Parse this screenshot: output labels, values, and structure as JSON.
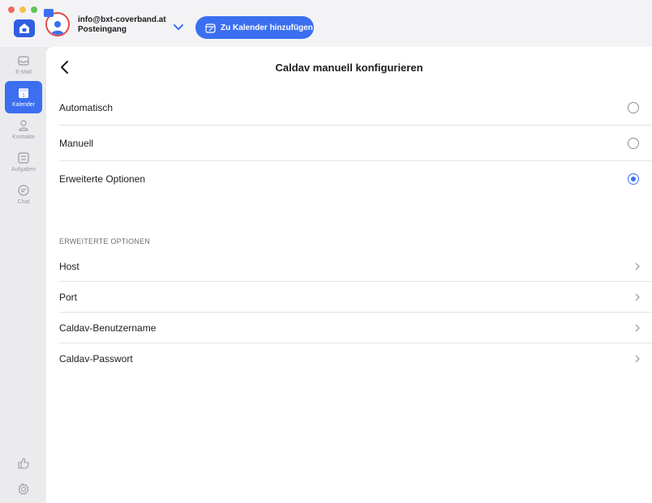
{
  "header": {
    "account_email": "info@bxt-coverband.at",
    "account_folder": "Posteingang",
    "add_calendar_label": "Zu Kalender hinzufügen",
    "accent_color": "#3b6ff0"
  },
  "sidebar": {
    "items": [
      {
        "label": "E-Mail",
        "icon": "mail-icon"
      },
      {
        "label": "Kalender",
        "icon": "calendar-icon",
        "active": true
      },
      {
        "label": "Kontakte",
        "icon": "contacts-icon"
      },
      {
        "label": "Aufgaben",
        "icon": "tasks-icon"
      },
      {
        "label": "Chat",
        "icon": "chat-icon"
      }
    ],
    "bottom_icons": [
      "thumbs-up-icon",
      "settings-gear-icon"
    ]
  },
  "page": {
    "title": "Caldav manuell konfigurieren",
    "options": [
      {
        "label": "Automatisch",
        "selected": false
      },
      {
        "label": "Manuell",
        "selected": false
      },
      {
        "label": "Erweiterte Optionen",
        "selected": true
      }
    ],
    "section_header": "ERWEITERTE OPTIONEN",
    "settings": [
      {
        "label": "Host"
      },
      {
        "label": "Port"
      },
      {
        "label": "Caldav-Benutzername"
      },
      {
        "label": "Caldav-Passwort"
      }
    ]
  }
}
